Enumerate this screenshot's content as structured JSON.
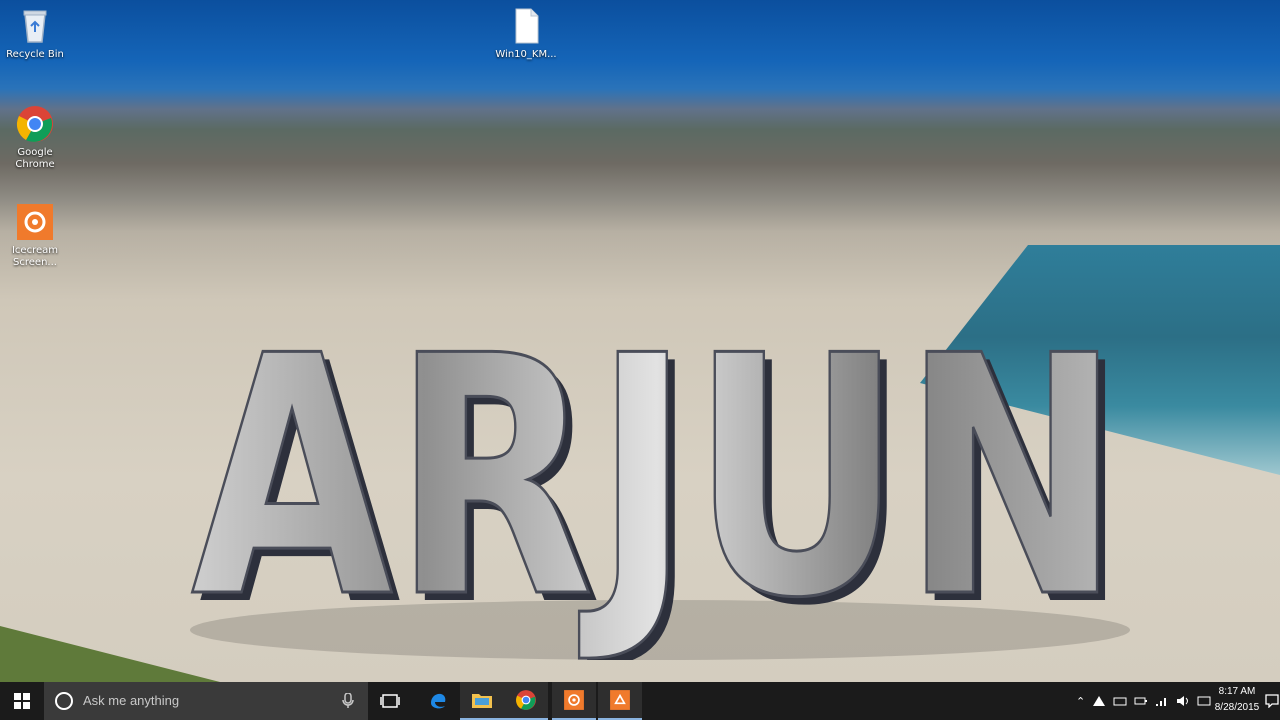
{
  "desktop": {
    "wallpaper_text": "ARJUN",
    "icons": [
      {
        "label": "Recycle Bin",
        "icon": "recycle-bin-icon"
      },
      {
        "label": "Win10_KM...",
        "icon": "file-icon"
      },
      {
        "label": "Google Chrome",
        "icon": "chrome-icon"
      },
      {
        "label": "Icecream Screen...",
        "icon": "icecream-icon"
      }
    ]
  },
  "taskbar": {
    "search_placeholder": "Ask me anything",
    "apps": [
      "task-view-icon",
      "edge-icon",
      "file-explorer-icon",
      "chrome-icon",
      "icecream-icon",
      "icecream-icon"
    ],
    "clock": {
      "time": "8:17 AM",
      "date": "8/28/2015"
    },
    "colors": {
      "background": "#1b1b1b",
      "search_bg": "#3a3a3a",
      "accent": "#8ab4e0"
    }
  }
}
